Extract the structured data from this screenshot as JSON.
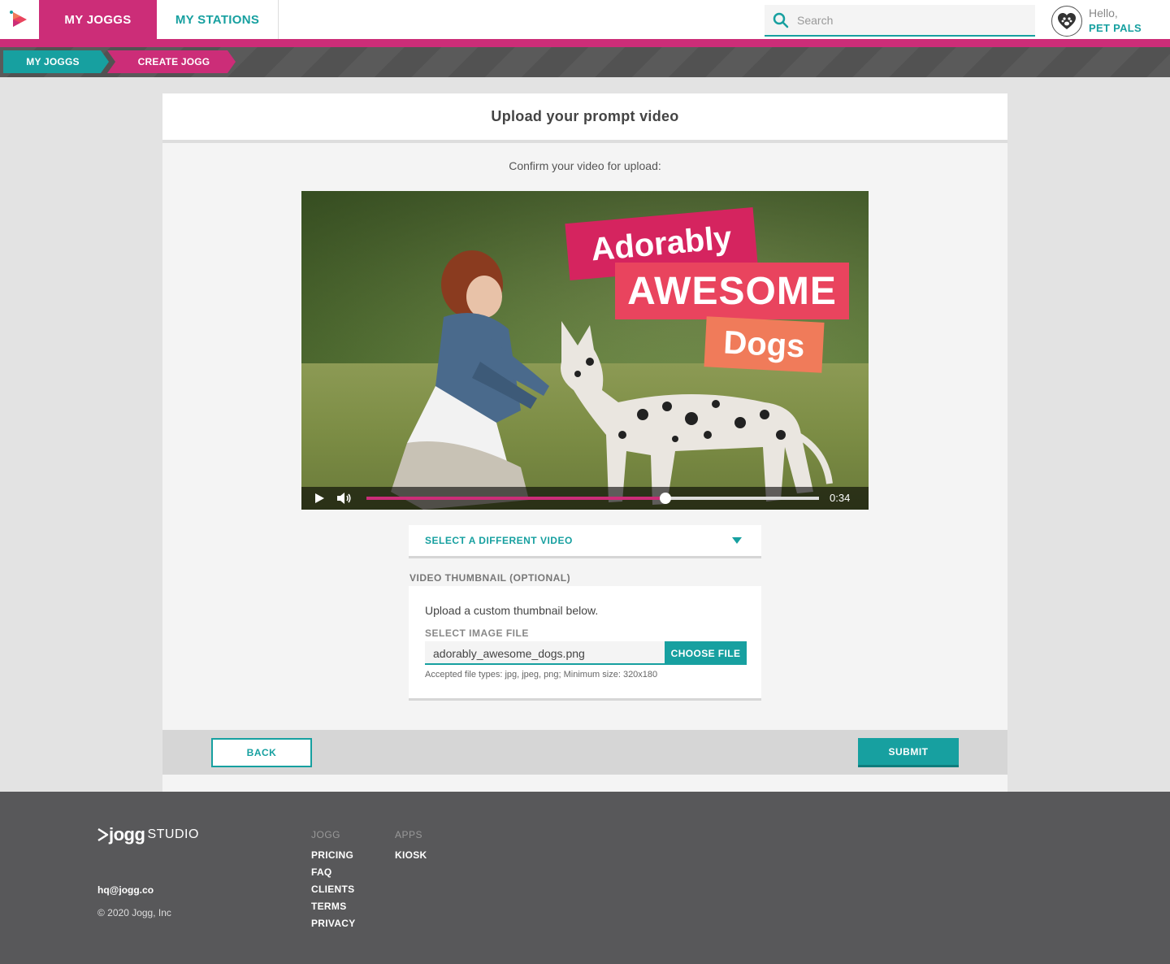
{
  "nav": {
    "tabs": [
      {
        "label": "MY JOGGS",
        "active": true
      },
      {
        "label": "MY STATIONS",
        "active": false
      }
    ],
    "search_placeholder": "Search",
    "greeting": "Hello,",
    "user_name": "PET PALS"
  },
  "breadcrumb": [
    "MY JOGGS",
    "CREATE JOGG"
  ],
  "card": {
    "title": "Upload your prompt video",
    "confirm_text": "Confirm your video for upload:",
    "video": {
      "overlay_lines": [
        "Adorably",
        "AWESOME",
        "Dogs"
      ],
      "time": "0:34",
      "progress_fraction": 0.66
    },
    "select_video_label": "SELECT A DIFFERENT VIDEO",
    "thumbnail": {
      "section_label": "VIDEO THUMBNAIL (OPTIONAL)",
      "instruction": "Upload a custom thumbnail below.",
      "file_label": "SELECT IMAGE FILE",
      "file_value": "adorably_awesome_dogs.png",
      "choose_button": "CHOOSE FILE",
      "accepted": "Accepted file types: jpg, jpeg, png; Minimum size: 320x180"
    },
    "back_button": "BACK",
    "submit_button": "SUBMIT"
  },
  "footer": {
    "brand": "jogg",
    "brand_suffix": "STUDIO",
    "email": "hq@jogg.co",
    "copyright": "© 2020 Jogg, Inc",
    "columns": [
      {
        "heading": "JOGG",
        "links": [
          "PRICING",
          "FAQ",
          "CLIENTS",
          "TERMS",
          "PRIVACY"
        ]
      },
      {
        "heading": "APPS",
        "links": [
          "KIOSK"
        ]
      }
    ]
  },
  "colors": {
    "brand_pink": "#cc2d78",
    "brand_teal": "#17a0a0",
    "footer_gray": "#58585a"
  }
}
